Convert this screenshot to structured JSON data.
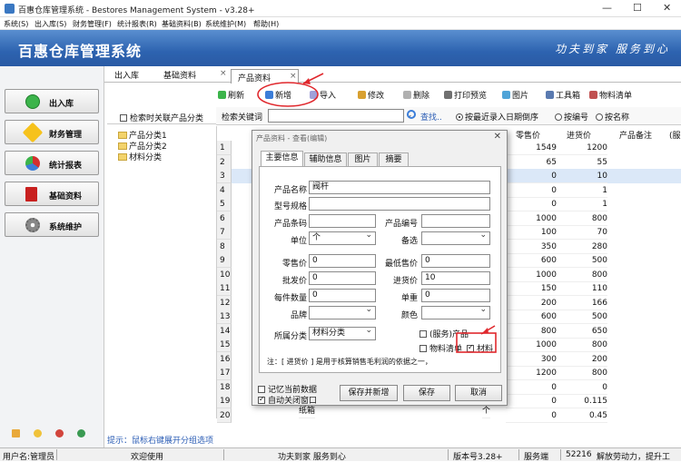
{
  "window": {
    "title": "百惠仓库管理系统 - Bestores Management System - v3.28+",
    "min": "—",
    "max": "☐",
    "close": "✕"
  },
  "menu": [
    "系统(S)",
    "出入库(S)",
    "财务管理(F)",
    "统计报表(R)",
    "基础资料(B)",
    "系统维护(M)",
    "帮助(H)"
  ],
  "banner": {
    "title": "百惠仓库管理系统",
    "slogan": "功夫到家  服务到心"
  },
  "nav": [
    {
      "label": "出入库",
      "icon": "check-circle-icon"
    },
    {
      "label": "财务管理",
      "icon": "star-icon"
    },
    {
      "label": "统计报表",
      "icon": "pie-chart-icon"
    },
    {
      "label": "基础资料",
      "icon": "book-icon"
    },
    {
      "label": "系统维护",
      "icon": "gear-icon"
    }
  ],
  "tabs": [
    "出入库",
    "基础资料",
    "产品资料"
  ],
  "tab_close": "×",
  "toolbar": [
    "刷新",
    "新增",
    "导入",
    "修改",
    "删除",
    "打印预览",
    "图片",
    "工具箱",
    "物料清单"
  ],
  "tree": {
    "check_label": "检索时关联产品分类",
    "items": [
      "产品分类1",
      "产品分类2",
      "材料分类"
    ],
    "hint": "提示：鼠标右键展开分组选项"
  },
  "search": {
    "label": "检索关键词",
    "find": "查找..",
    "options": [
      "按最近录入日期倒序",
      "按编号",
      "按名称"
    ]
  },
  "grid": {
    "headers": [
      "零售价",
      "进货价",
      "产品备注",
      "(服"
    ],
    "rows": [
      {
        "n": "1",
        "retail": "1549",
        "cost": "1200"
      },
      {
        "n": "2",
        "retail": "65",
        "cost": "55"
      },
      {
        "n": "3",
        "retail": "0",
        "cost": "10"
      },
      {
        "n": "4",
        "retail": "0",
        "cost": "1"
      },
      {
        "n": "5",
        "retail": "0",
        "cost": "1"
      },
      {
        "n": "6",
        "retail": "1000",
        "cost": "800"
      },
      {
        "n": "7",
        "retail": "100",
        "cost": "70"
      },
      {
        "n": "8",
        "retail": "350",
        "cost": "280"
      },
      {
        "n": "9",
        "retail": "600",
        "cost": "500"
      },
      {
        "n": "10",
        "retail": "1000",
        "cost": "800"
      },
      {
        "n": "11",
        "retail": "150",
        "cost": "110"
      },
      {
        "n": "12",
        "retail": "200",
        "cost": "166"
      },
      {
        "n": "13",
        "retail": "600",
        "cost": "500"
      },
      {
        "n": "14",
        "retail": "800",
        "cost": "650"
      },
      {
        "n": "15",
        "retail": "1000",
        "cost": "800"
      },
      {
        "n": "16",
        "retail": "300",
        "cost": "200"
      },
      {
        "n": "17",
        "retail": "1200",
        "cost": "800"
      },
      {
        "n": "18",
        "retail": "0",
        "cost": "0"
      },
      {
        "n": "19",
        "retail": "0",
        "cost": "0.115"
      },
      {
        "n": "20",
        "retail": "0",
        "cost": "0.45"
      }
    ],
    "row20_name": "纸箱",
    "row20_unit": "个"
  },
  "dialog": {
    "title": "产品资料 - 查看(编辑)",
    "close": "✕",
    "tabs": [
      "主要信息",
      "辅助信息",
      "图片",
      "摘要"
    ],
    "fields": {
      "name_label": "产品名称",
      "name_value": "阀杆",
      "spec_label": "型号规格",
      "barcode_label": "产品条码",
      "code_label": "产品编号",
      "unit_label": "单位",
      "unit_value": "个",
      "memo_label": "备选",
      "retail_label": "零售价",
      "retail_value": "0",
      "minprice_label": "最低售价",
      "minprice_value": "0",
      "wholesale_label": "批发价",
      "wholesale_value": "0",
      "cost_label": "进货价",
      "cost_value": "10",
      "qty_label": "每件数量",
      "qty_value": "0",
      "weight_label": "单重",
      "weight_value": "0",
      "brand_label": "品牌",
      "color_label": "颜色",
      "category_label": "所属分类",
      "category_value": "材料分类",
      "service_label": "(服务)产品",
      "bom_label": "物料清单",
      "material_label": "材料"
    },
    "note": "注：[ 进货价 ] 是用于核算销售毛利润的依据之一，",
    "remember": "记忆当前数据",
    "autoclose": "自动关闭窗口",
    "btn_save_new": "保存并新增",
    "btn_save": "保存",
    "btn_cancel": "取消"
  },
  "status": {
    "user": "用户名:管理员",
    "welcome": "欢迎使用",
    "motto": "功夫到家 服务到心",
    "version": "版本号3.28+",
    "service": "服务端",
    "port": "52216",
    "scroll": "解放劳动力，提升工"
  },
  "colors": {
    "banner": "#2d63b0",
    "accent_red": "#e0282d",
    "hint_blue": "#2b5db5"
  }
}
